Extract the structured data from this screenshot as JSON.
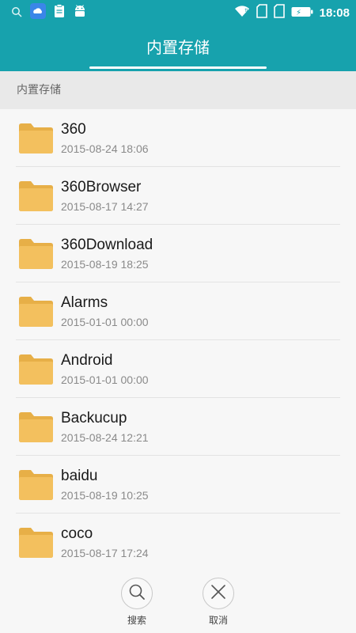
{
  "status_bar": {
    "time": "18:08",
    "icons": [
      "search-icon",
      "weather-app-icon",
      "clipboard-icon",
      "android-icon",
      "wifi-icon",
      "sim-card-icon",
      "sim-card-icon",
      "battery-icon"
    ]
  },
  "header": {
    "title": "内置存储"
  },
  "breadcrumb": {
    "path": "内置存储"
  },
  "files": [
    {
      "name": "360",
      "date": "2015-08-24 18:06",
      "icon": "folder-icon"
    },
    {
      "name": "360Browser",
      "date": "2015-08-17 14:27",
      "icon": "folder-icon"
    },
    {
      "name": "360Download",
      "date": "2015-08-19 18:25",
      "icon": "folder-icon"
    },
    {
      "name": "Alarms",
      "date": "2015-01-01 00:00",
      "icon": "folder-icon"
    },
    {
      "name": "Android",
      "date": "2015-01-01 00:00",
      "icon": "folder-icon"
    },
    {
      "name": "Backucup",
      "date": "2015-08-24 12:21",
      "icon": "folder-icon"
    },
    {
      "name": "baidu",
      "date": "2015-08-19 10:25",
      "icon": "folder-icon"
    },
    {
      "name": "coco",
      "date": "2015-08-17 17:24",
      "icon": "folder-icon"
    }
  ],
  "actions": {
    "search_label": "搜索",
    "cancel_label": "取消"
  },
  "colors": {
    "primary": "#17a2ad",
    "folder": "#f3c05e",
    "folder_dark": "#e7af47"
  }
}
